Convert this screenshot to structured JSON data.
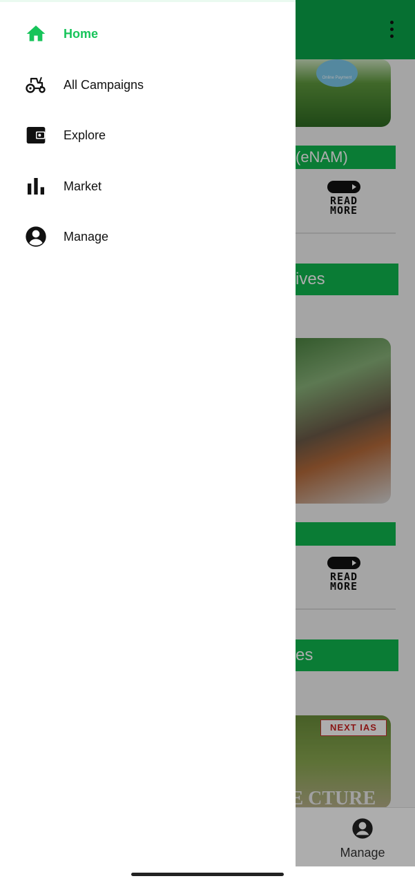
{
  "background_app": {
    "band1_text": "(eNAM)",
    "band2_text": "ives",
    "band4_text": "es",
    "payment_badge": "Online Payment",
    "read_more_1": "READ MORE",
    "read_more_2": "READ MORE",
    "next_ias": "NEXT IAS",
    "ghost_text": "URE CTURE",
    "bottom_nav": {
      "manage_label": "Manage",
      "manage_icon": "account-circle-icon"
    }
  },
  "drawer": {
    "items": [
      {
        "label": "Home",
        "icon": "home-icon",
        "active": true
      },
      {
        "label": "All Campaigns",
        "icon": "tractor-icon",
        "active": false
      },
      {
        "label": "Explore",
        "icon": "wallet-icon",
        "active": false
      },
      {
        "label": "Market",
        "icon": "bar-chart-icon",
        "active": false
      },
      {
        "label": "Manage",
        "icon": "account-circle-icon",
        "active": false
      }
    ]
  },
  "colors": {
    "accent": "#17c45a",
    "topbar": "#0aa64a",
    "band": "#0fb74f"
  }
}
